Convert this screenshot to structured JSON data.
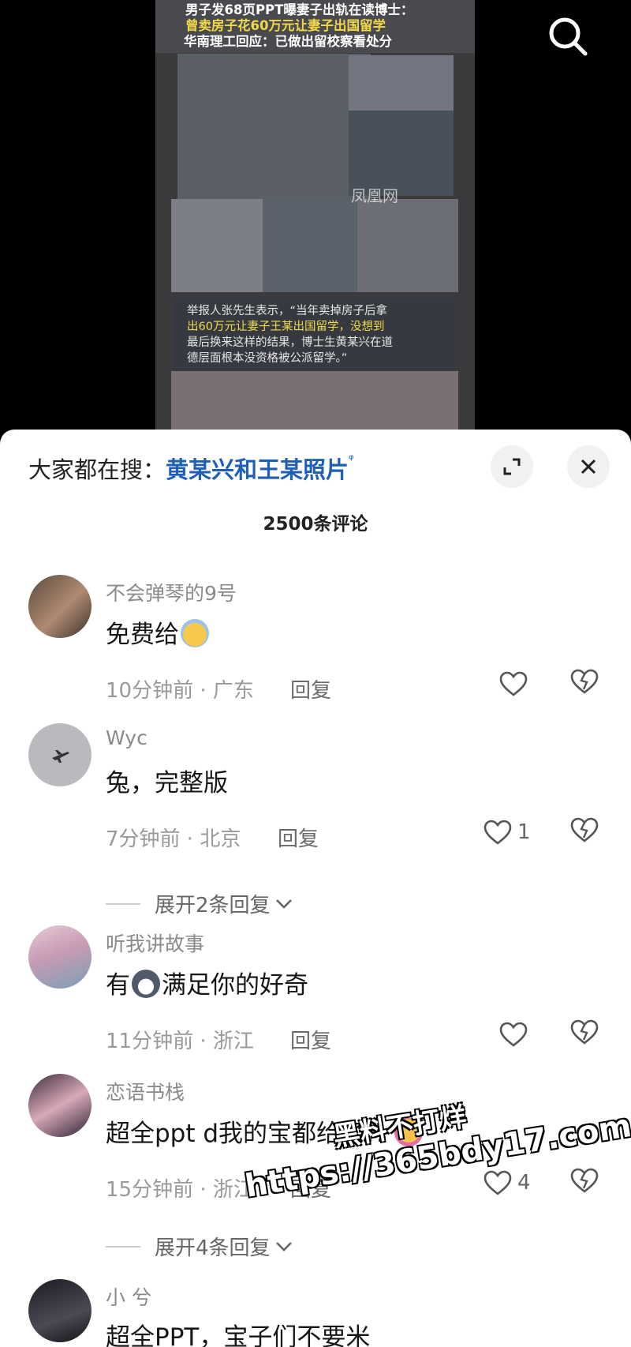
{
  "video": {
    "headline_lines": [
      "男子发68页PPT曝妻子出轨在读博士：",
      "曾卖房子花60万元让妻子出国留学",
      "华南理工回应：已做出留校察看处分"
    ],
    "quote_lines": [
      "举报人张先生表示，“当年卖掉房子后拿",
      "出60万元让妻子王某出国留学，没想到",
      "最后换来这样的结果，博士生黄某兴在道",
      "德层面根本没资格被公派留学。”"
    ],
    "watermark": "凤凰网",
    "search_icon": "search-icon"
  },
  "sheet": {
    "trending_prefix": "大家都在搜：",
    "trending_term": "黄某兴和王某照片",
    "trending_suffix": "ᵠ",
    "count_label": "2500条评论"
  },
  "comments": [
    {
      "username": "不会弹琴的9号",
      "text": "免费给",
      "time_loc": "10分钟前 · 广东",
      "reply": "回复",
      "likes": "",
      "expand": ""
    },
    {
      "username": "Wyc",
      "text": "兔，完整版",
      "time_loc": "7分钟前 · 北京",
      "reply": "回复",
      "likes": "1",
      "expand": "展开2条回复"
    },
    {
      "username": "听我讲故事",
      "text_pre": "有",
      "text_post": "满足你的好奇",
      "time_loc": "11分钟前 · 浙江",
      "reply": "回复",
      "likes": "",
      "expand": ""
    },
    {
      "username": "恋语书栈",
      "text": "超全ppt  d我的宝都给了!! ",
      "time_loc": "15分钟前 · 浙江",
      "reply": "回复",
      "likes": "4",
      "expand": "展开4条回复"
    },
    {
      "username": "小 兮",
      "text": "超全PPT，宝子们不要米"
    }
  ],
  "overlay": {
    "line1": "黑料不打烊",
    "line2": "https://365bdy17.com"
  },
  "colors": {
    "accent": "#1f5fb4",
    "headline_highlight": "#f2d94a",
    "sheet_bg": "#ffffff"
  }
}
